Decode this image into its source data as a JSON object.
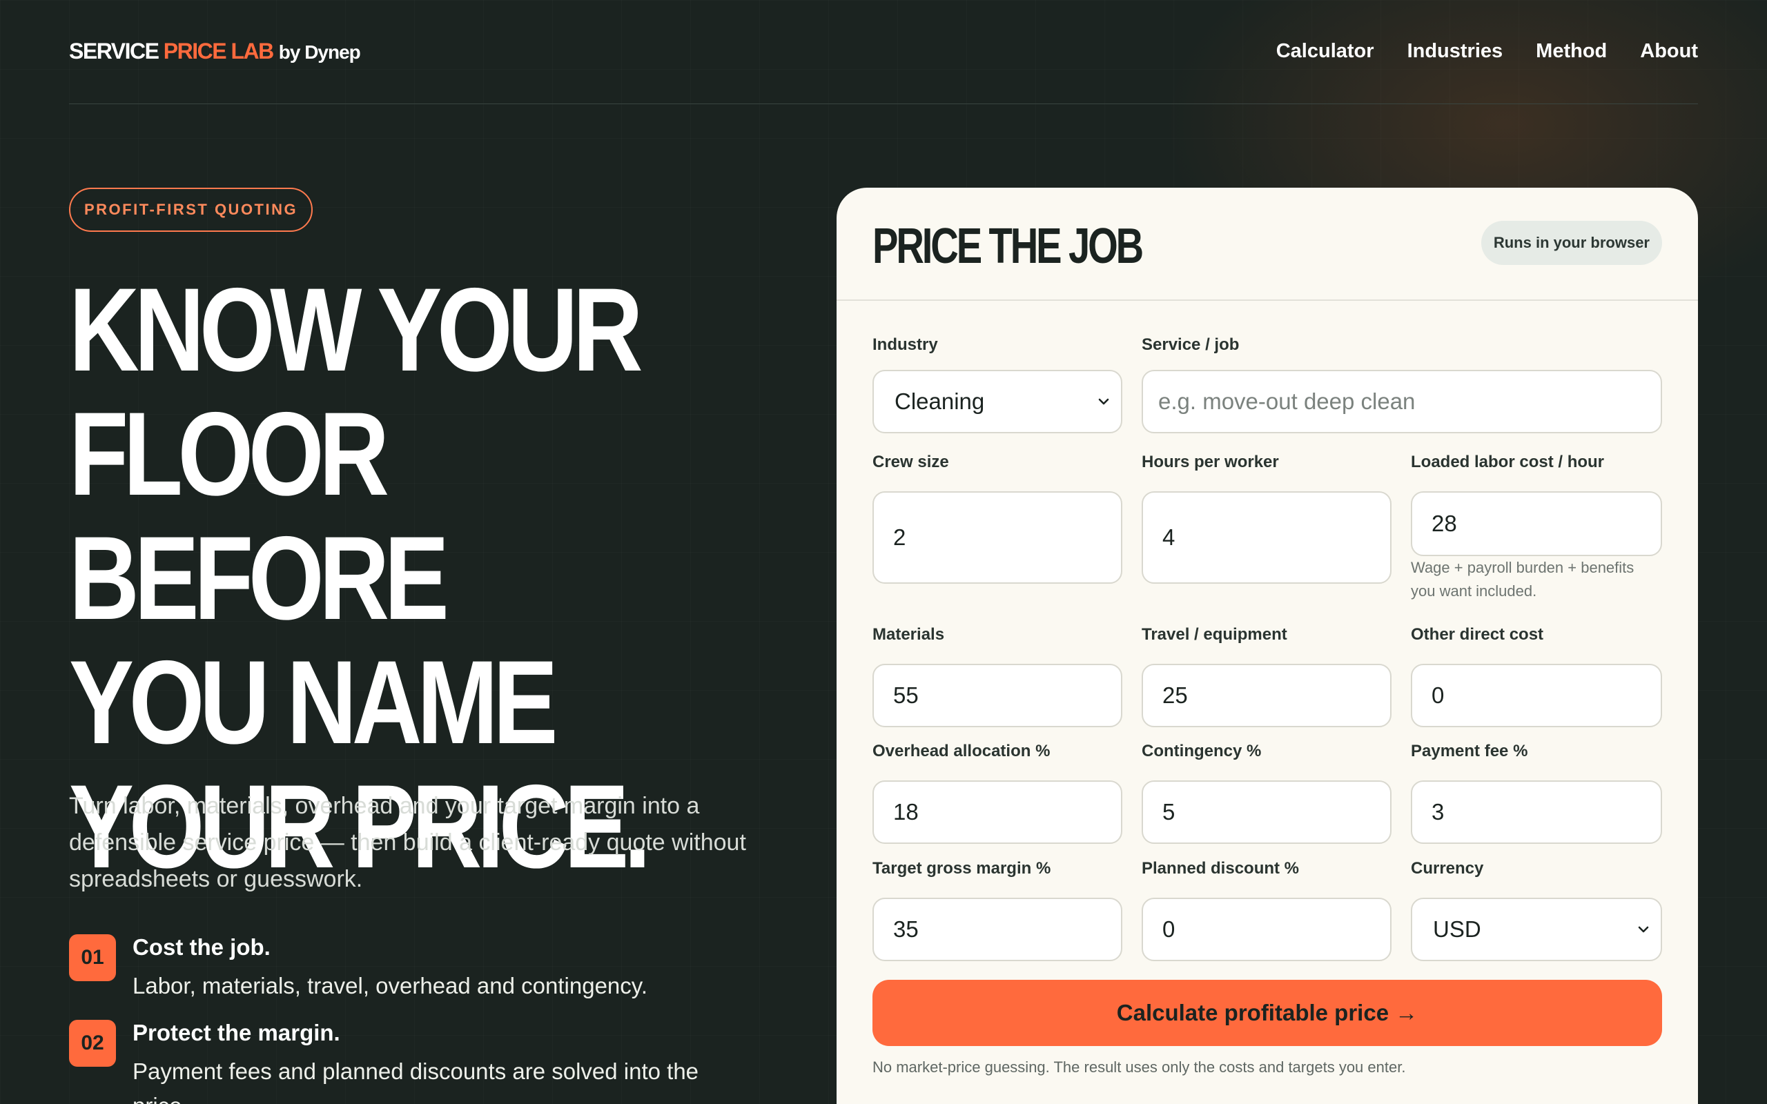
{
  "brand": {
    "part1": "SERVICE ",
    "part2": "PRICE LAB",
    "part3": "by Dynep"
  },
  "nav": {
    "links": [
      "Calculator",
      "Industries",
      "Method",
      "About"
    ]
  },
  "hero": {
    "pill": "PROFIT-FIRST QUOTING",
    "headline": [
      "KNOW YOUR",
      "FLOOR BEFORE",
      "YOU NAME",
      "YOUR PRICE."
    ],
    "lede": "Turn labor, materials, overhead and your target margin into a defensible service price — then build a client-ready quote without spreadsheets or guesswork.",
    "steps": [
      {
        "num": "01",
        "title": "Cost the job.",
        "desc": "Labor, materials, travel, overhead and contingency."
      },
      {
        "num": "02",
        "title": "Protect the margin.",
        "desc": "Payment fees and planned discounts are solved into the price."
      }
    ]
  },
  "card": {
    "title": "PRICE THE JOB",
    "badge": "Runs in your browser",
    "fields": {
      "industry": {
        "label": "Industry",
        "value": "Cleaning"
      },
      "service": {
        "label": "Service / job",
        "placeholder": "e.g. move-out deep clean",
        "value": ""
      },
      "crew_size": {
        "label": "Crew size",
        "value": "2"
      },
      "hours": {
        "label": "Hours per worker",
        "value": "4"
      },
      "labor_cost": {
        "label": "Loaded labor cost / hour",
        "value": "28",
        "hint": "Wage + payroll burden + benefits you want included."
      },
      "materials": {
        "label": "Materials",
        "value": "55"
      },
      "travel": {
        "label": "Travel / equipment",
        "value": "25"
      },
      "other": {
        "label": "Other direct cost",
        "value": "0"
      },
      "overhead": {
        "label": "Overhead allocation %",
        "value": "18"
      },
      "contingency": {
        "label": "Contingency %",
        "value": "5"
      },
      "payment_fee": {
        "label": "Payment fee %",
        "value": "3"
      },
      "margin": {
        "label": "Target gross margin %",
        "value": "35"
      },
      "discount": {
        "label": "Planned discount %",
        "value": "0"
      },
      "currency": {
        "label": "Currency",
        "value": "USD"
      }
    },
    "cta": "Calculate profitable price →",
    "footnote": "No market-price guessing. The result uses only the costs and targets you enter."
  },
  "colors": {
    "accent": "#ff6a3d",
    "background": "#1b2320",
    "card": "#fbf9f2"
  }
}
